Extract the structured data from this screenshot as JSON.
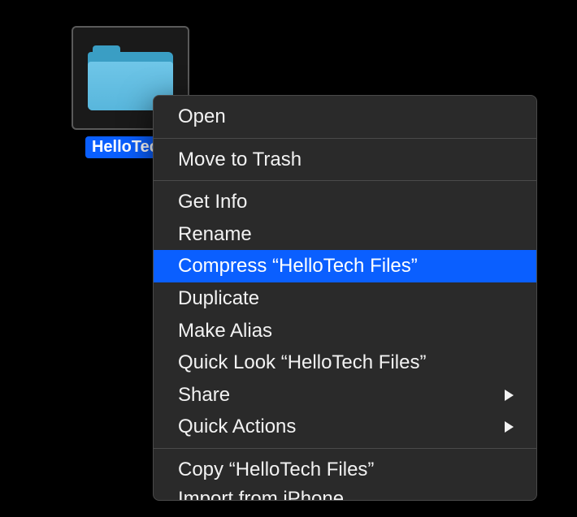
{
  "folder": {
    "name": "HelloTech"
  },
  "menu": {
    "open": "Open",
    "move_to_trash": "Move to Trash",
    "get_info": "Get Info",
    "rename": "Rename",
    "compress": "Compress “HelloTech Files”",
    "duplicate": "Duplicate",
    "make_alias": "Make Alias",
    "quick_look": "Quick Look “HelloTech Files”",
    "share": "Share",
    "quick_actions": "Quick Actions",
    "copy": "Copy “HelloTech Files”",
    "import_from_iphone": "Import from iPhone"
  }
}
